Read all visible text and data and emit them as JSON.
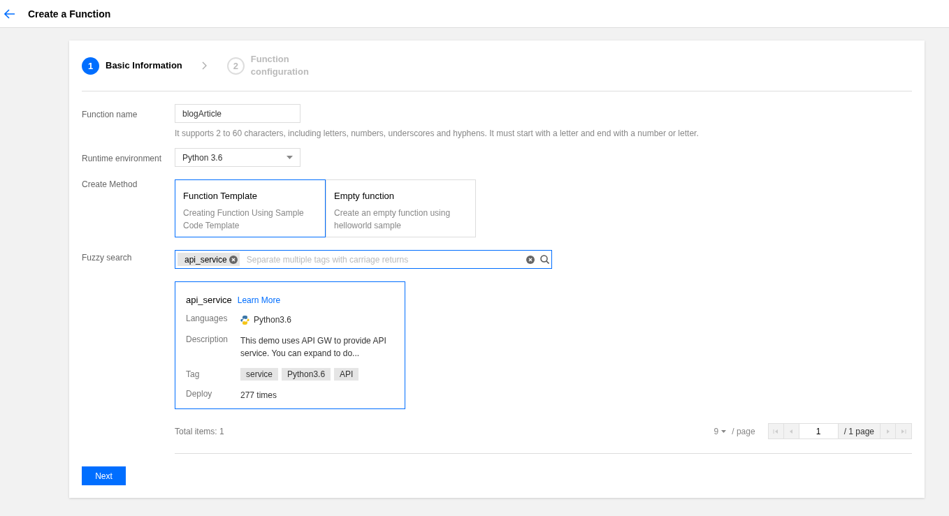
{
  "header": {
    "title": "Create a Function"
  },
  "steps": [
    {
      "number": "1",
      "label": "Basic Information",
      "selected": true
    },
    {
      "number": "2",
      "label": "Function configuration",
      "selected": false
    }
  ],
  "form": {
    "name_label": "Function name",
    "name_value": "blogArticle",
    "name_hint": "It supports 2 to 60 characters, including letters, numbers, underscores and hyphens. It must start with a letter and end with a number or letter.",
    "runtime_label": "Runtime environment",
    "runtime_value": "Python 3.6",
    "method_label": "Create Method",
    "methods": [
      {
        "title": "Function Template",
        "description": "Creating Function Using Sample Code Template",
        "selected": true
      },
      {
        "title": "Empty function",
        "description": "Create an empty function using helloworld sample",
        "selected": false
      }
    ],
    "search_label": "Fuzzy search",
    "search_tags": [
      "api_service"
    ],
    "search_placeholder": "Separate multiple tags with carriage returns"
  },
  "template": {
    "name": "api_service",
    "link": "Learn More",
    "languages_label": "Languages",
    "language": "Python3.6",
    "description_label": "Description",
    "description": "This demo uses API GW to provide API service. You can expand to do...",
    "tag_label": "Tag",
    "tags": [
      "service",
      "Python3.6",
      "API"
    ],
    "deploy_label": "Deploy",
    "deploy": "277 times"
  },
  "pagination": {
    "total": "Total items:  1",
    "page_size": "9",
    "per_page": "/ page",
    "page": "1",
    "pages": "/ 1 page",
    "first_disabled": true,
    "prev_disabled": true,
    "next_disabled": true,
    "last_disabled": true
  },
  "buttons": {
    "next": "Next"
  }
}
